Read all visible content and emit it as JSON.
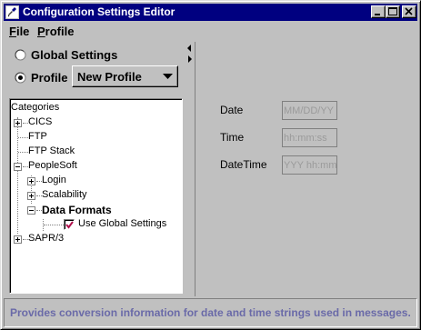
{
  "window": {
    "title": "Configuration Settings Editor"
  },
  "menu": {
    "file": {
      "accel": "F",
      "rest": "ile"
    },
    "profile": {
      "accel": "P",
      "rest": "rofile"
    }
  },
  "scope": {
    "global_label": "Global Settings",
    "profile_label": "Profile",
    "selected": "profile",
    "profile_select_value": "New Profile"
  },
  "tree": {
    "root_label": "Categories",
    "nodes": [
      {
        "label": "CICS",
        "expander": "plus"
      },
      {
        "label": "FTP",
        "expander": "none"
      },
      {
        "label": "FTP Stack",
        "expander": "none"
      },
      {
        "label": "PeopleSoft",
        "expander": "minus"
      },
      {
        "label": "Login",
        "expander": "plus"
      },
      {
        "label": "Scalability",
        "expander": "plus"
      },
      {
        "label": "Data Formats",
        "expander": "minus",
        "bold": true
      },
      {
        "label": "Use Global Settings",
        "checkbox": true,
        "checked": true
      },
      {
        "label": "SAPR/3",
        "expander": "plus"
      }
    ]
  },
  "fields": {
    "date": {
      "label": "Date",
      "placeholder": "MM/DD/YY"
    },
    "time": {
      "label": "Time",
      "placeholder": "hh:mm:ss"
    },
    "datetime": {
      "label": "DateTime",
      "placeholder": "YYY hh:mm"
    }
  },
  "status": {
    "text": "Provides conversion information for date and time strings used in messages."
  },
  "colors": {
    "titlebar": "#000080",
    "face": "#c0c0c0",
    "status_text": "#6a6aa8",
    "check_mark": "#b0104c"
  }
}
